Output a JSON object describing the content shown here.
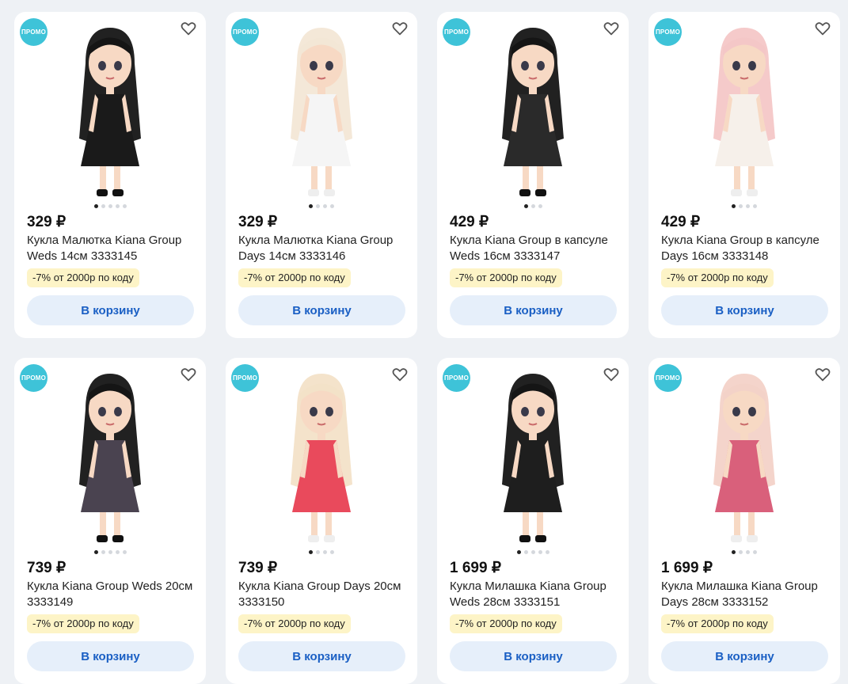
{
  "products": [
    {
      "promo": "ПРОМО",
      "price": "329 ₽",
      "title": "Кукла Малютка Kiana Group Weds 14см 3333145",
      "discount": "-7% от 2000р по коду",
      "cart": "В корзину",
      "dots": 5,
      "hair": "#151515",
      "dress": "#1a1a1a",
      "style": "dark"
    },
    {
      "promo": "ПРОМО",
      "price": "329 ₽",
      "title": "Кукла Малютка Kiana Group Days 14см 3333146",
      "discount": "-7% от 2000р по коду",
      "cart": "В корзину",
      "dots": 4,
      "hair": "#f3e7d6",
      "dress": "#f5f5f5",
      "style": "light"
    },
    {
      "promo": "ПРОМО",
      "price": "429 ₽",
      "title": "Кукла Kiana Group в капсуле Weds 16см 3333147",
      "discount": "-7% от 2000р по коду",
      "cart": "В корзину",
      "dots": 3,
      "hair": "#151515",
      "dress": "#2a2a2a",
      "style": "dark"
    },
    {
      "promo": "ПРОМО",
      "price": "429 ₽",
      "title": "Кукла Kiana Group в капсуле Days 16см 3333148",
      "discount": "-7% от 2000р по коду",
      "cart": "В корзину",
      "dots": 4,
      "hair": "#f4c7c7",
      "dress": "#f6f0ea",
      "style": "light"
    },
    {
      "promo": "ПРОМО",
      "price": "739 ₽",
      "title": "Кукла Kiana Group Weds 20см 3333149",
      "discount": "-7% от 2000р по коду",
      "cart": "В корзину",
      "dots": 5,
      "hair": "#151515",
      "dress": "#4a4350",
      "style": "dark"
    },
    {
      "promo": "ПРОМО",
      "price": "739 ₽",
      "title": "Кукла Kiana Group Days 20см 3333150",
      "discount": "-7% от 2000р по коду",
      "cart": "В корзину",
      "dots": 4,
      "hair": "#f3e2c8",
      "dress": "#e94a5c",
      "style": "light"
    },
    {
      "promo": "ПРОМО",
      "price": "1 699 ₽",
      "title": "Кукла Милашка Kiana Group Weds 28см 3333151",
      "discount": "-7% от 2000р по коду",
      "cart": "В корзину",
      "dots": 5,
      "hair": "#151515",
      "dress": "#1e1e1e",
      "style": "dark"
    },
    {
      "promo": "ПРОМО",
      "price": "1 699 ₽",
      "title": "Кукла Милашка Kiana Group Days 28см 3333152",
      "discount": "-7% от 2000р по коду",
      "cart": "В корзину",
      "dots": 4,
      "hair": "#f3d2c8",
      "dress": "#d9607b",
      "style": "light"
    }
  ]
}
